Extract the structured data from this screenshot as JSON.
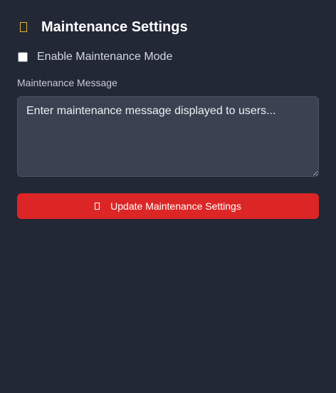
{
  "header": {
    "icon": "tools-icon",
    "icon_color": "#e5b92c",
    "title": "Maintenance Settings"
  },
  "maintenance_mode": {
    "label": "Enable Maintenance Mode",
    "checked": false
  },
  "message": {
    "label": "Maintenance Message",
    "placeholder": "Enter maintenance message displayed to users...",
    "value": ""
  },
  "update_button": {
    "icon": "save-icon",
    "label": "Update Maintenance Settings",
    "color": "#dc2626"
  },
  "colors": {
    "background": "#222836",
    "input_background": "#3a4252"
  }
}
